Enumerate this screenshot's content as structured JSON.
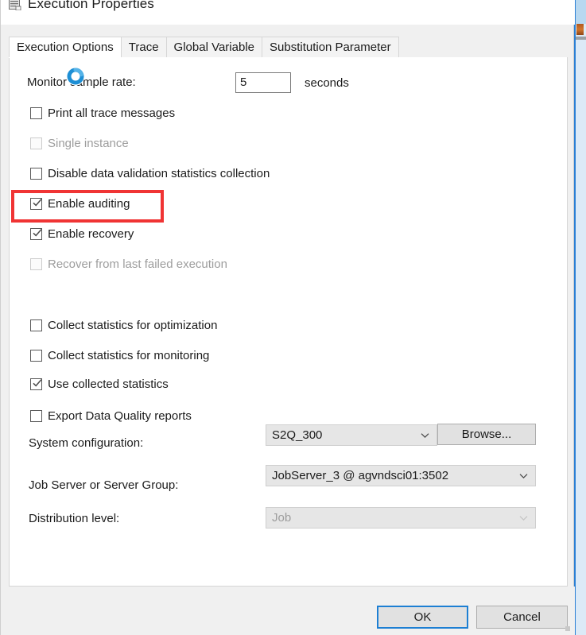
{
  "window": {
    "title": "Execution Properties",
    "icon": "document-properties-icon",
    "controls": {
      "minimize": "–",
      "maximize": "□",
      "close": "✕"
    }
  },
  "tabs": [
    {
      "label": "Execution Options",
      "active": true
    },
    {
      "label": "Trace",
      "active": false
    },
    {
      "label": "Global Variable",
      "active": false
    },
    {
      "label": "Substitution Parameter",
      "active": false
    }
  ],
  "execution_options": {
    "monitor_sample_rate": {
      "label": "Monitor sample rate:",
      "value": "5",
      "unit": "seconds"
    },
    "checkboxes": [
      {
        "label": "Print all trace messages",
        "checked": false,
        "disabled": false
      },
      {
        "label": "Single instance",
        "checked": false,
        "disabled": true
      },
      {
        "label": "Disable data validation statistics collection",
        "checked": false,
        "disabled": false
      },
      {
        "label": "Enable auditing",
        "checked": true,
        "disabled": false,
        "highlighted": true
      },
      {
        "label": "Enable recovery",
        "checked": true,
        "disabled": false
      },
      {
        "label": "Recover from last failed execution",
        "checked": false,
        "disabled": true
      },
      {
        "label": "Collect statistics for optimization",
        "checked": false,
        "disabled": false
      },
      {
        "label": "Collect statistics for monitoring",
        "checked": false,
        "disabled": false
      },
      {
        "label": "Use collected statistics",
        "checked": true,
        "disabled": false
      },
      {
        "label": "Export Data Quality reports",
        "checked": false,
        "disabled": false
      }
    ],
    "system_configuration": {
      "label": "System configuration:",
      "value": "S2Q_300",
      "browse_label": "Browse..."
    },
    "job_server": {
      "label": "Job Server or Server Group:",
      "value": "JobServer_3 @ agvndsci01:3502"
    },
    "distribution_level": {
      "label": "Distribution level:",
      "value": "Job",
      "disabled": true
    }
  },
  "footer": {
    "ok_label": "OK",
    "cancel_label": "Cancel"
  },
  "colors": {
    "annotation": "#f03434",
    "default_button_border": "#1d7fd3",
    "dialog_bg": "#f0f0f0",
    "panel_bg": "#ffffff",
    "combo_bg": "#e6e6e6",
    "disabled_text": "#9d9d9d"
  }
}
